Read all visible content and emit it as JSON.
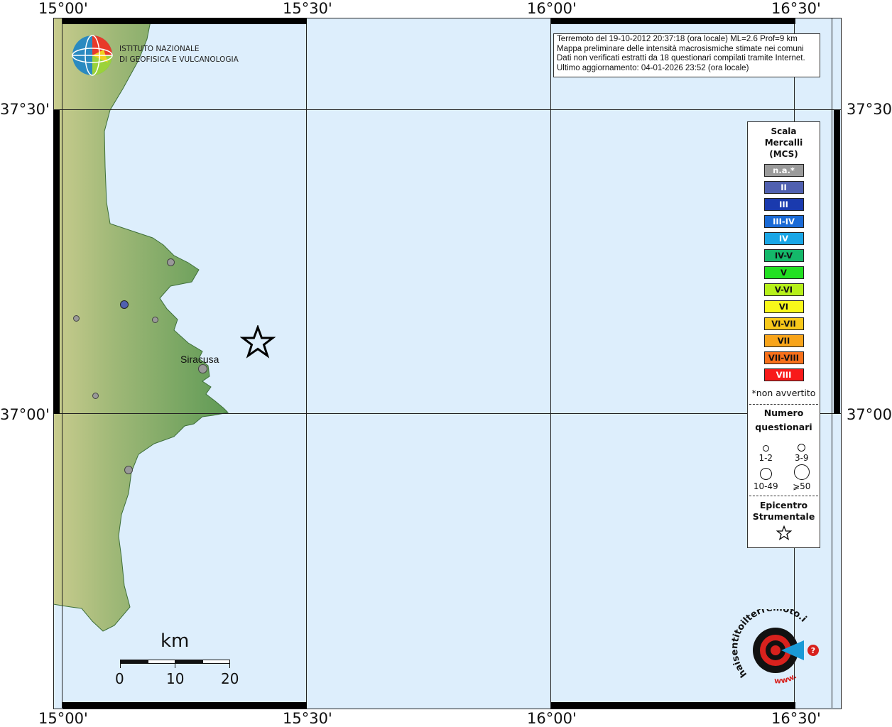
{
  "map": {
    "top_lon_labels": [
      "15°00'",
      "15°30'",
      "16°00'",
      "16°30'"
    ],
    "bottom_lon_labels": [
      "15°00'",
      "15°30'",
      "16°00'",
      "16°30'"
    ],
    "left_lat_labels": [
      "37°30'",
      "37°00'"
    ],
    "right_lat_labels": [
      "37°30'",
      "37°00'"
    ],
    "city_label": "Siracusa",
    "colors": {
      "sea": "#ddeefc",
      "land_green": "#6f9f5e",
      "land_light": "#b9c787",
      "grid": "#222222"
    }
  },
  "logo": {
    "name_line1": "ISTITUTO NAZIONALE",
    "name_line2": "DI GEOFISICA E VULCANOLOGIA"
  },
  "info": {
    "line1": "Terremoto del 19-10-2012 20:37:18 (ora locale) ML=2.6 Prof=9 km",
    "line2": "Mappa preliminare delle intensità macrosismiche stimate nei comuni",
    "line3": "Dati non verificati estratti da 18 questionari compilati tramite Internet.",
    "line4": "Ultimo aggiornamento: 04-01-2026 23:52 (ora locale)"
  },
  "legend": {
    "title1": "Scala",
    "title2": "Mercalli",
    "title3": "(MCS)",
    "items": [
      {
        "label": "n.a.*",
        "color": "#9a9a9a",
        "text": "#ffffff"
      },
      {
        "label": "II",
        "color": "#5060b0",
        "text": "#ffffff"
      },
      {
        "label": "III",
        "color": "#1a3aae",
        "text": "#ffffff"
      },
      {
        "label": "III-IV",
        "color": "#1a6ad6",
        "text": "#ffffff"
      },
      {
        "label": "IV",
        "color": "#19a6e6",
        "text": "#ffffff"
      },
      {
        "label": "IV-V",
        "color": "#14b86a",
        "text": "#111111"
      },
      {
        "label": "V",
        "color": "#22e022",
        "text": "#111111"
      },
      {
        "label": "V-VI",
        "color": "#b6f01a",
        "text": "#111111"
      },
      {
        "label": "VI",
        "color": "#f8f81a",
        "text": "#111111"
      },
      {
        "label": "VI-VII",
        "color": "#f8c81a",
        "text": "#111111"
      },
      {
        "label": "VII",
        "color": "#f8a41a",
        "text": "#111111"
      },
      {
        "label": "VII-VIII",
        "color": "#f8701a",
        "text": "#111111"
      },
      {
        "label": "VIII",
        "color": "#f81a1a",
        "text": "#ffffff"
      }
    ],
    "note": "*non avvertito",
    "q_title1": "Numero",
    "q_title2": "questionari",
    "q_labels": [
      "1-2",
      "3-9",
      "10-49",
      "⩾50"
    ],
    "epi_title1": "Epicentro",
    "epi_title2": "Strumentale"
  },
  "scale_bar": {
    "unit": "km",
    "ticks": [
      "0",
      "10",
      "20"
    ]
  },
  "points": [
    {
      "type": "grey"
    },
    {
      "type": "blue"
    },
    {
      "type": "grey"
    },
    {
      "type": "grey"
    },
    {
      "type": "grey"
    },
    {
      "type": "grey"
    },
    {
      "type": "grey"
    }
  ],
  "brand": {
    "text": "haisentitoilterremoto.it",
    "url": "www."
  }
}
